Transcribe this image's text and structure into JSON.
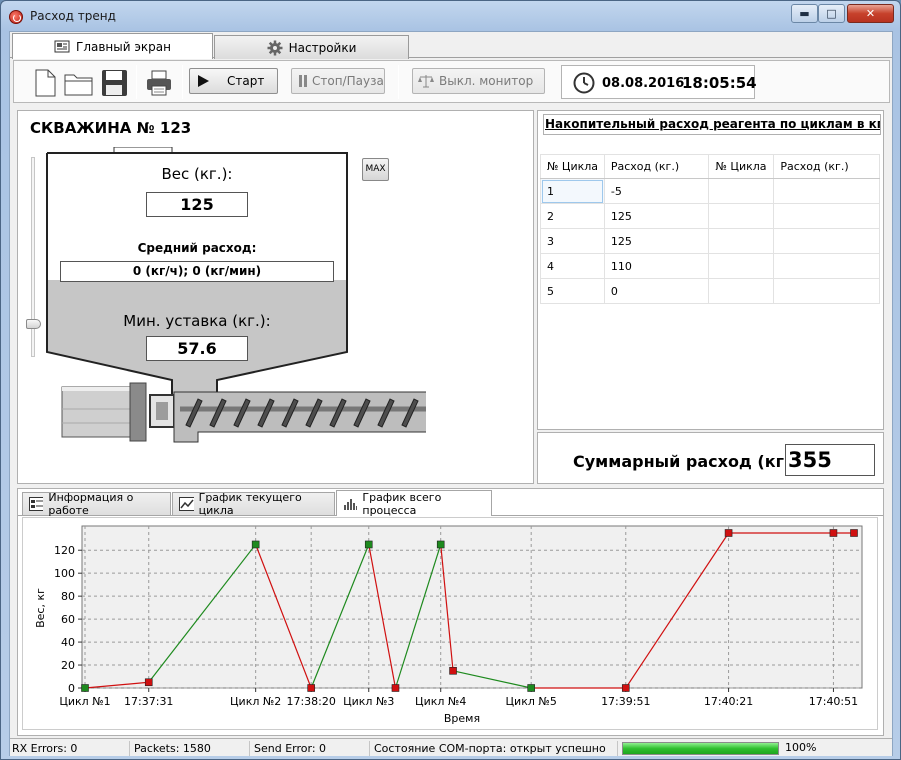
{
  "window": {
    "title": "Расход тренд",
    "min": "▬",
    "max": "□",
    "close": "✕"
  },
  "tabs": [
    {
      "label": "Главный экран"
    },
    {
      "label": "Настройки"
    }
  ],
  "toolbar": {
    "start": "Старт",
    "stop": "Стоп/Пауза",
    "monitor": "Выкл. монитор",
    "date": "08.08.2016",
    "time": "18:05:54"
  },
  "well": {
    "title": "СКВАЖИНА № 123",
    "max_button": "MAX",
    "weight_label": "Вес (кг.):",
    "weight_value": "125",
    "avg_label": "Средний расход:",
    "avg_value": "0 (кг/ч);  0 (кг/мин)",
    "min_label": "Мин. уставка (кг.):",
    "min_value": "57.6"
  },
  "cumulative": {
    "title": "Накопительный расход реагента по циклам  в кг.",
    "columns": [
      "№ Цикла",
      "Расход (кг.)",
      "№ Цикла",
      "Расход (кг.)"
    ],
    "rows": [
      [
        "1",
        "-5",
        "",
        ""
      ],
      [
        "2",
        "125",
        "",
        ""
      ],
      [
        "3",
        "125",
        "",
        ""
      ],
      [
        "4",
        "110",
        "",
        ""
      ],
      [
        "5",
        "0",
        "",
        ""
      ]
    ]
  },
  "total": {
    "label": "Суммарный расход (кг.):",
    "value": "355"
  },
  "bottom_tabs": [
    {
      "label": "Информация о работе"
    },
    {
      "label": "График текущего цикла"
    },
    {
      "label": "График всего процесса"
    }
  ],
  "status": {
    "rx": "RX Errors: 0",
    "packets": "Packets: 1580",
    "send": "Send Error: 0",
    "com": "Состояние COM-порта: открыт успешно",
    "progress_text": "100%",
    "progress": 1.0
  },
  "chart_data": {
    "type": "line",
    "xlabel": "Время",
    "ylabel": "Вес, кг",
    "ylim": [
      0,
      135
    ],
    "yticks": [
      0,
      20,
      40,
      60,
      80,
      100,
      120
    ],
    "xticks": [
      {
        "label": "Цикл №1",
        "t": 0
      },
      {
        "label": "17:37:31",
        "t": 31
      },
      {
        "label": "Цикл №2",
        "t": 83
      },
      {
        "label": "17:38:20",
        "t": 110
      },
      {
        "label": "Цикл №3",
        "t": 138
      },
      {
        "label": "Цикл №4",
        "t": 173
      },
      {
        "label": "Цикл №5",
        "t": 217
      },
      {
        "label": "17:39:51",
        "t": 263
      },
      {
        "label": "17:40:21",
        "t": 313
      },
      {
        "label": "17:40:51",
        "t": 364
      }
    ],
    "xlim": [
      0,
      374
    ],
    "points": [
      {
        "t": 0,
        "v": 0,
        "c": "g"
      },
      {
        "t": 31,
        "v": 5,
        "c": "r"
      },
      {
        "t": 83,
        "v": 125,
        "c": "g"
      },
      {
        "t": 110,
        "v": 0,
        "c": "r"
      },
      {
        "t": 138,
        "v": 125,
        "c": "g"
      },
      {
        "t": 151,
        "v": 0,
        "c": "r"
      },
      {
        "t": 173,
        "v": 125,
        "c": "g"
      },
      {
        "t": 179,
        "v": 15,
        "c": "r"
      },
      {
        "t": 217,
        "v": 0,
        "c": "g"
      },
      {
        "t": 263,
        "v": 0,
        "c": "r"
      },
      {
        "t": 313,
        "v": 135,
        "c": "r"
      },
      {
        "t": 364,
        "v": 135,
        "c": "r"
      },
      {
        "t": 374,
        "v": 135,
        "c": "r"
      }
    ],
    "colors": {
      "g": "#1e8a1e",
      "r": "#d01010"
    }
  }
}
